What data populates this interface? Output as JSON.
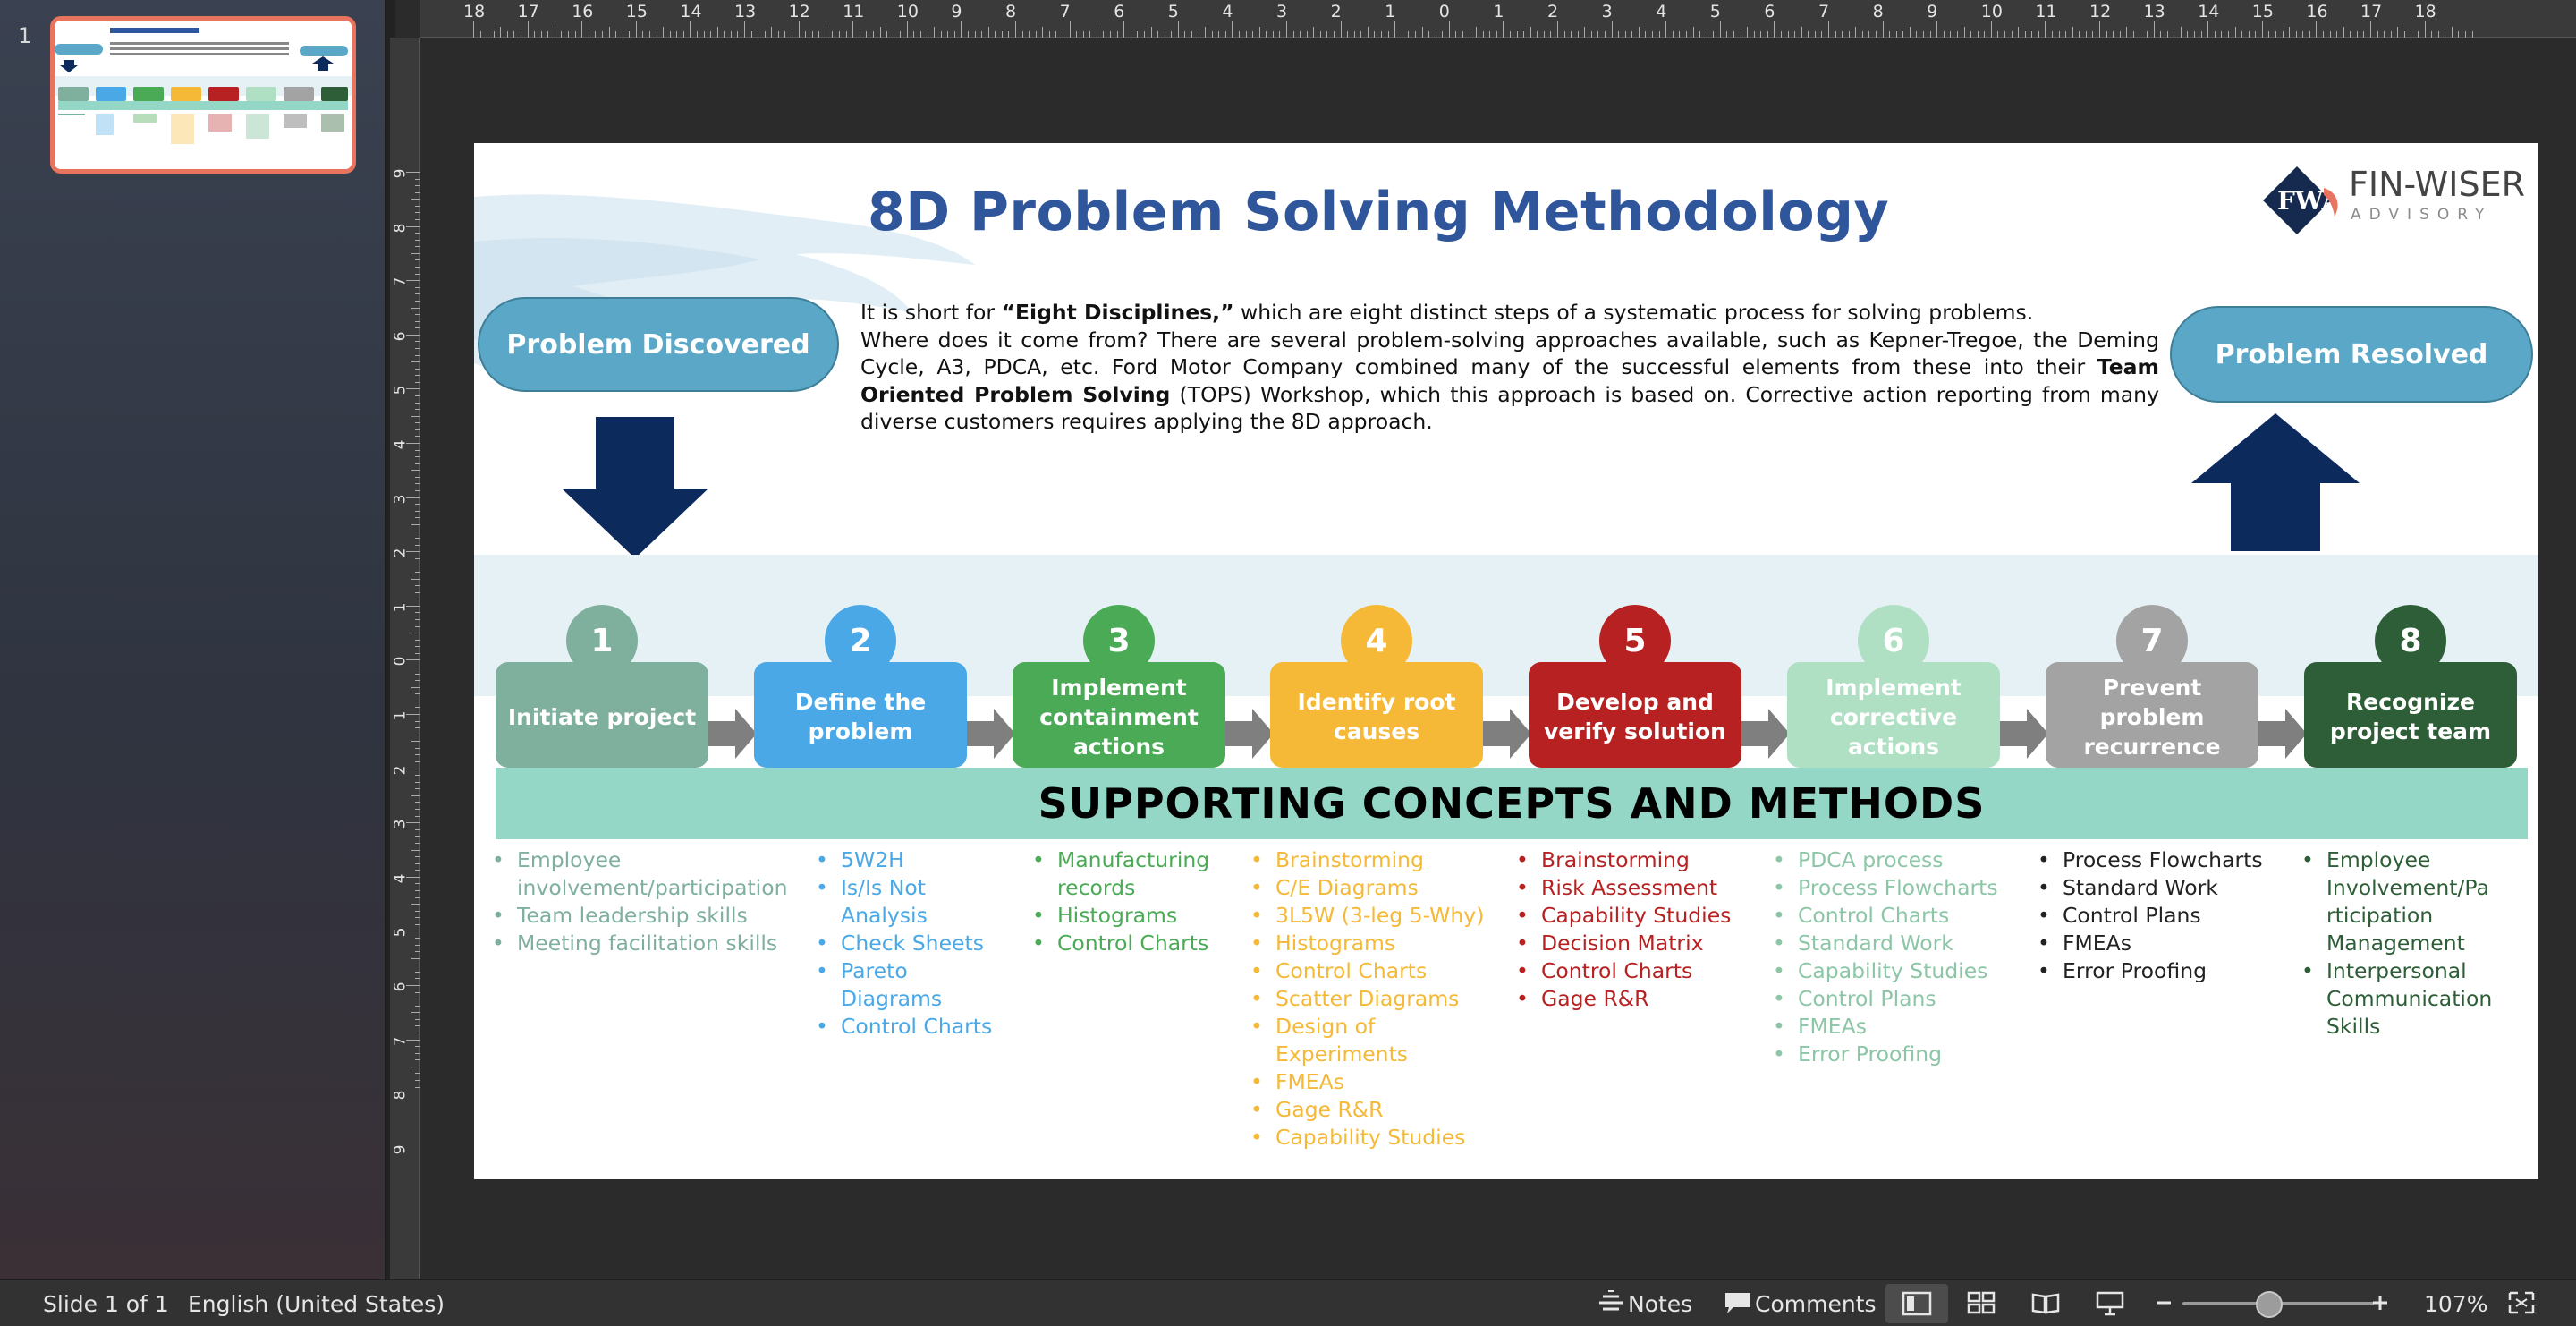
{
  "thumbnail": {
    "slide_number": "1"
  },
  "ruler": {
    "top": [
      "18",
      "17",
      "16",
      "15",
      "14",
      "13",
      "12",
      "11",
      "10",
      "9",
      "8",
      "7",
      "6",
      "5",
      "4",
      "3",
      "2",
      "1",
      "0",
      "1",
      "2",
      "3",
      "4",
      "5",
      "6",
      "7",
      "8",
      "9",
      "10",
      "11",
      "12",
      "13",
      "14",
      "15",
      "16",
      "17",
      "18"
    ],
    "left": [
      "9",
      "8",
      "7",
      "6",
      "5",
      "4",
      "3",
      "2",
      "1",
      "0",
      "1",
      "2",
      "3",
      "4",
      "5",
      "6",
      "7",
      "8",
      "9"
    ]
  },
  "slide": {
    "title": "8D Problem Solving Methodology",
    "logo": {
      "name": "FIN-WISER",
      "sub": "ADVISORY",
      "mark": "FWA"
    },
    "pill_discovered": "Problem Discovered",
    "pill_resolved": "Problem Resolved",
    "intro": {
      "line1_a": "It is short for ",
      "line1_b": "“Eight Disciplines,”",
      "line1_c": " which are eight distinct steps of a systematic process for solving problems.",
      "line2_a": "Where does it come from? There are several problem-solving approaches available, such as Kepner-Tregoe, the Deming Cycle, A3, PDCA, etc. Ford Motor Company combined many of the successful elements from these into their ",
      "line2_b": "Team Oriented Problem Solving",
      "line2_c": " (TOPS) Workshop, which this approach is based on. Corrective action reporting from many diverse customers requires applying the 8D approach."
    },
    "steps": [
      {
        "num": "1",
        "label": "Initiate project",
        "color": "#7faf9d"
      },
      {
        "num": "2",
        "label": "Define the problem",
        "color": "#4aa8e6"
      },
      {
        "num": "3",
        "label": "Implement containment actions",
        "color": "#4aaa55"
      },
      {
        "num": "4",
        "label": "Identify root causes",
        "color": "#f5b937"
      },
      {
        "num": "5",
        "label": "Develop and verify solution",
        "color": "#b72121"
      },
      {
        "num": "6",
        "label": "Implement corrective actions",
        "color": "#b0e0c4"
      },
      {
        "num": "7",
        "label": "Prevent problem recurrence",
        "color": "#a3a3a3"
      },
      {
        "num": "8",
        "label": "Recognize project team",
        "color": "#2e5e38"
      }
    ],
    "supporting_title": "SUPPORTING CONCEPTS AND METHODS",
    "columns": [
      {
        "color": "#7faf9d",
        "items": [
          "Employee involvement/participation",
          "Team leadership skills",
          "Meeting facilitation skills"
        ]
      },
      {
        "color": "#4aa8e6",
        "items": [
          "5W2H",
          "Is/Is Not Analysis",
          "Check Sheets",
          "Pareto Diagrams",
          "Control Charts"
        ]
      },
      {
        "color": "#4aaa55",
        "items": [
          "Manufacturing records",
          "Histograms",
          "Control Charts"
        ]
      },
      {
        "color": "#f5b937",
        "items": [
          "Brainstorming",
          "C/E Diagrams",
          "3L5W (3-leg 5-Why)",
          "Histograms",
          "Control Charts",
          "Scatter Diagrams",
          "Design of Experiments",
          "FMEAs",
          "Gage R&R",
          "Capability Studies"
        ]
      },
      {
        "color": "#b72121",
        "items": [
          "Brainstorming",
          "Risk Assessment",
          "Capability Studies",
          "Decision Matrix",
          "Control Charts",
          "Gage R&R"
        ]
      },
      {
        "color": "#8cc6a6",
        "items": [
          "PDCA process",
          "Process Flowcharts",
          "Control Charts",
          "Standard Work",
          "Capability Studies",
          "Control Plans",
          "FMEAs",
          "Error Proofing"
        ]
      },
      {
        "color": "#222222",
        "items": [
          "Process Flowcharts",
          "Standard Work",
          "Control Plans",
          "FMEAs",
          "Error Proofing"
        ]
      },
      {
        "color": "#2e5e38",
        "items": [
          "Employee Involvement/Pa rticipation Management",
          "Interpersonal Communication Skills"
        ]
      }
    ]
  },
  "statusbar": {
    "slide_info": "Slide 1 of 1",
    "language": "English (United States)",
    "notes": "Notes",
    "comments": "Comments",
    "zoom": "107%",
    "zoom_level_percent": 107
  }
}
